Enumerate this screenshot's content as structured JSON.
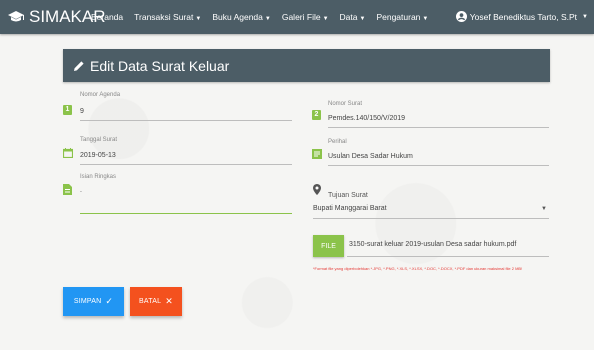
{
  "app": {
    "name": "SIMAKAR"
  },
  "nav": {
    "items": [
      {
        "label": "Beranda",
        "dropdown": false
      },
      {
        "label": "Transaksi Surat",
        "dropdown": true
      },
      {
        "label": "Buku Agenda",
        "dropdown": true
      },
      {
        "label": "Galeri File",
        "dropdown": true
      },
      {
        "label": "Data",
        "dropdown": true
      },
      {
        "label": "Pengaturan",
        "dropdown": true
      }
    ],
    "user": "Yosef Benediktus Tarto, S.Pt"
  },
  "form": {
    "title": "Edit Data Surat Keluar",
    "nomor_agenda": {
      "label": "Nomor Agenda",
      "value": "9"
    },
    "nomor_surat": {
      "label": "Nomor Surat",
      "value": "Pemdes.140/150/V/2019"
    },
    "tanggal_surat": {
      "label": "Tanggal Surat",
      "value": "2019-05-13"
    },
    "perihal": {
      "label": "Perihal",
      "value": "Usulan Desa Sadar Hukum"
    },
    "isian_ringkas": {
      "label": "Isian Ringkas",
      "value": "."
    },
    "tujuan_surat": {
      "label": "Tujuan Surat",
      "value": "Bupati Manggarai Barat"
    },
    "file": {
      "button_label": "FILE",
      "filename": "3150-surat keluar 2019-usulan Desa sadar hukum.pdf"
    },
    "note": "*Format file yang diperbolehkan *.JPG, *.PNG, *.XLS, *.XLSX, *.DOC, *.DOCX, *.PDF dan ukuran maksimal file 2 MB!",
    "save_label": "SIMPAN",
    "cancel_label": "BATAL"
  },
  "colors": {
    "navbar": "#4c5d66",
    "accent_green": "#8bc34a",
    "save_blue": "#2196f3",
    "cancel_orange": "#f4511e",
    "note_red": "#e53935"
  },
  "icons": {
    "brand": "graduation-cap-icon",
    "user": "account-circle-icon",
    "header": "pencil-icon",
    "nomor_agenda": "numeric-1-box-icon",
    "nomor_surat": "numeric-2-box-icon",
    "tanggal_surat": "calendar-icon",
    "perihal": "subject-icon",
    "isian_ringkas": "file-document-icon",
    "tujuan_surat": "map-marker-icon",
    "save": "check-icon",
    "cancel": "close-icon"
  }
}
